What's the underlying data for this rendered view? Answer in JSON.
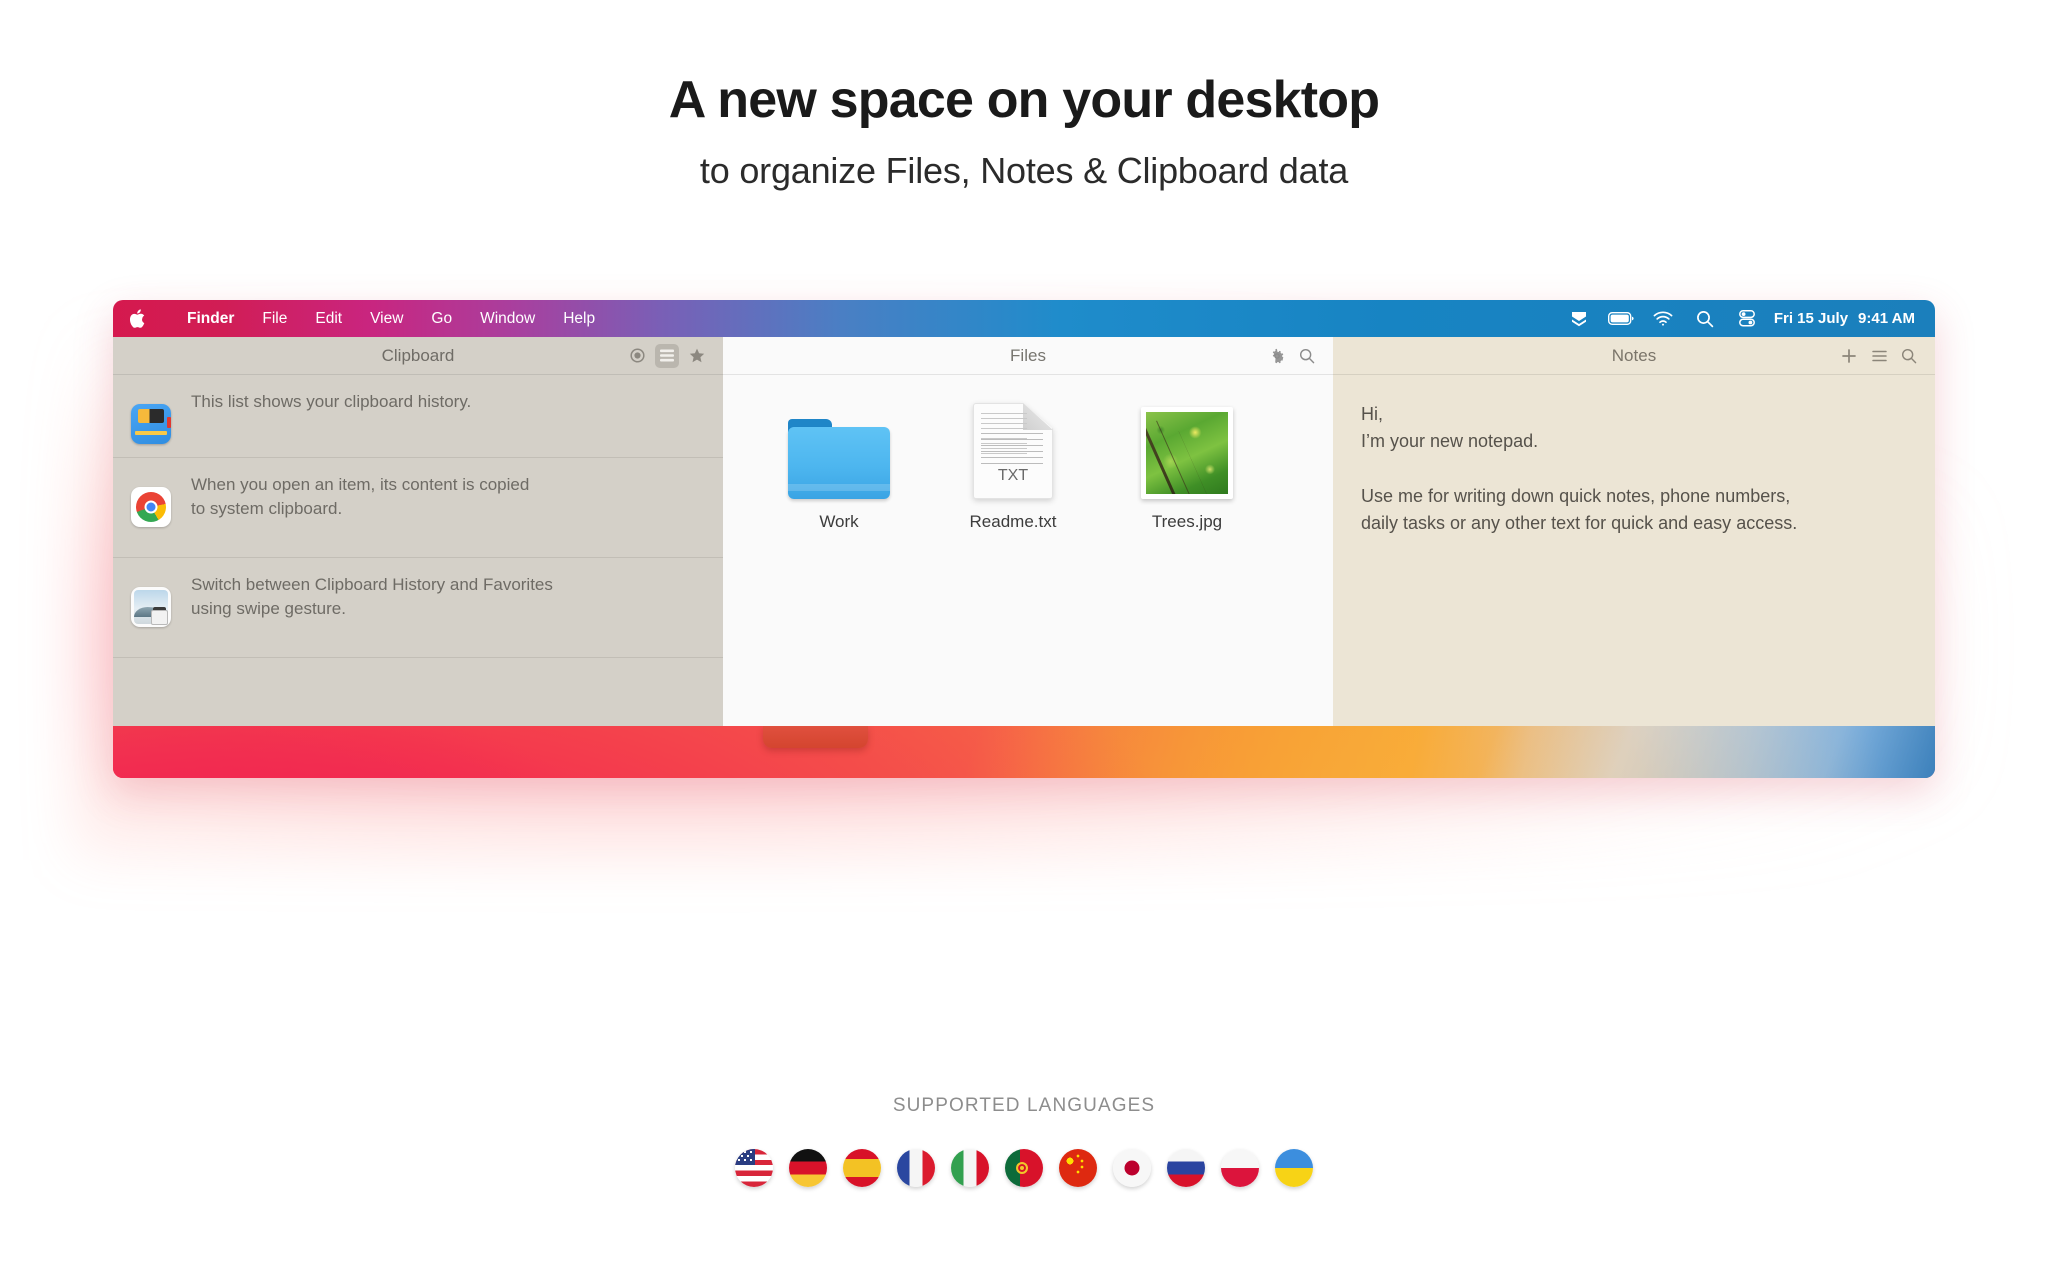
{
  "hero": {
    "title": "A new space on your desktop",
    "subtitle": "to organize Files, Notes & Clipboard data"
  },
  "menubar": {
    "apple_glyph": "",
    "items": [
      {
        "label": "Finder",
        "bold": true
      },
      {
        "label": "File",
        "bold": false
      },
      {
        "label": "Edit",
        "bold": false
      },
      {
        "label": "View",
        "bold": false
      },
      {
        "label": "Go",
        "bold": false
      },
      {
        "label": "Window",
        "bold": false
      },
      {
        "label": "Help",
        "bold": false
      }
    ],
    "status_icons": [
      "dropbox-icon",
      "battery-icon",
      "wifi-icon",
      "search-icon",
      "control-center-icon"
    ],
    "date": "Fri 15 July",
    "time": "9:41 AM"
  },
  "clipboard_panel": {
    "title": "Clipboard",
    "tools": [
      {
        "name": "record-icon",
        "selected": false
      },
      {
        "name": "list-icon",
        "selected": true
      },
      {
        "name": "star-icon",
        "selected": false
      }
    ],
    "items": [
      {
        "icon": "paste-app-icon",
        "text": "This list shows your clipboard history."
      },
      {
        "icon": "chrome-icon",
        "text": "When you open an item, its content is copied\nto system clipboard."
      },
      {
        "icon": "preview-app-icon",
        "text": "Switch between Clipboard History and Favorites\nusing swipe gesture."
      }
    ]
  },
  "files_panel": {
    "title": "Files",
    "tools": [
      "gear-icon",
      "search-icon"
    ],
    "items": [
      {
        "icon": "folder-icon",
        "label": "Work",
        "ext": ""
      },
      {
        "icon": "text-document-icon",
        "label": "Readme.txt",
        "ext": "TXT"
      },
      {
        "icon": "image-thumbnail-icon",
        "label": "Trees.jpg",
        "ext": ""
      }
    ]
  },
  "notes_panel": {
    "title": "Notes",
    "tools": [
      "plus-icon",
      "list-icon",
      "search-icon"
    ],
    "body": "Hi,\nI’m your new notepad.\n\nUse me for writing down quick notes, phone numbers,\ndaily tasks or any other text for quick and easy access."
  },
  "languages": {
    "title": "SUPPORTED LANGUAGES",
    "flags": [
      {
        "code": "us",
        "name": "united-states"
      },
      {
        "code": "de",
        "name": "germany"
      },
      {
        "code": "es",
        "name": "spain"
      },
      {
        "code": "fr",
        "name": "france"
      },
      {
        "code": "it",
        "name": "italy"
      },
      {
        "code": "pt",
        "name": "portugal"
      },
      {
        "code": "cn",
        "name": "china"
      },
      {
        "code": "jp",
        "name": "japan"
      },
      {
        "code": "ru",
        "name": "russia"
      },
      {
        "code": "pl",
        "name": "poland"
      },
      {
        "code": "ua",
        "name": "ukraine"
      }
    ]
  },
  "colors": {
    "menubar_start": "#d5194e",
    "menubar_end": "#1b7fbc",
    "clipboard_bg": "#d4d0c8",
    "files_bg": "#fafafa",
    "notes_bg": "#ece5d5",
    "wallpaper_red": "#f4494b",
    "wallpaper_orange": "#f9a434",
    "wallpaper_blue": "#1565a8",
    "handle_tab": "#d4452f"
  }
}
